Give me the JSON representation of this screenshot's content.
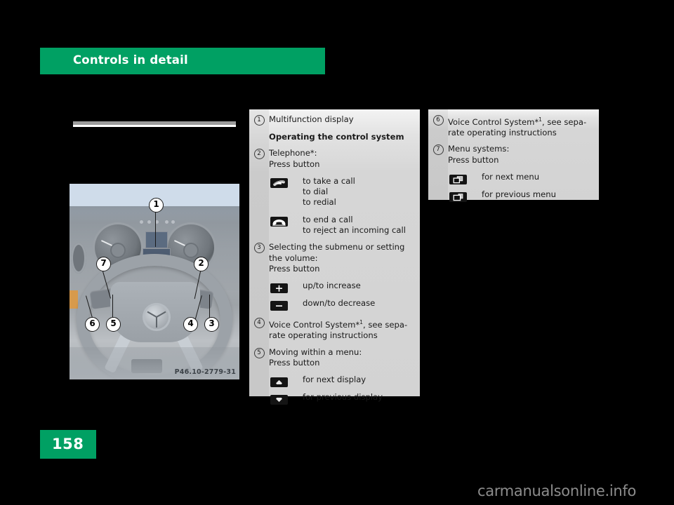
{
  "header": {
    "title": "Controls in detail",
    "band_color": "#00a063"
  },
  "figure": {
    "reference_code": "P46.10-2779-31",
    "callouts": [
      "1",
      "2",
      "3",
      "4",
      "5",
      "6",
      "7"
    ],
    "alt": "Mercedes-Benz steering wheel and instrument cluster with numbered callouts"
  },
  "panel_middle": {
    "items": [
      {
        "num": "1",
        "text": "Multifunction display"
      },
      {
        "heading": "Operating the control system"
      },
      {
        "num": "2",
        "text": "Telephone*:\nPress button",
        "subitems": [
          {
            "icon": "phone-take-call-icon",
            "text": "to take a call\nto dial\nto redial"
          },
          {
            "icon": "phone-end-call-icon",
            "text": "to end a call\nto reject an incoming call"
          }
        ]
      },
      {
        "num": "3",
        "text": "Selecting the submenu or setting the volume:\nPress button",
        "subitems": [
          {
            "icon": "plus-icon",
            "text": "up/to increase"
          },
          {
            "icon": "minus-icon",
            "text": "down/to decrease"
          }
        ]
      },
      {
        "num": "4",
        "text": "Voice Control System*",
        "superscript": "1",
        "text_after": ", see separate operating instructions"
      },
      {
        "num": "5",
        "text": "Moving within a menu:\nPress button",
        "subitems": [
          {
            "icon": "arrow-up-icon",
            "text": "for next display"
          },
          {
            "icon": "arrow-down-icon",
            "text": "for previous display"
          }
        ]
      }
    ],
    "row1_label": "Multifunction display",
    "row2_heading": "Operating the control system",
    "row3_label": "Telephone*:",
    "row3_label2": "Press button",
    "row3_sub1_line1": "to take a call",
    "row3_sub1_line2": "to dial",
    "row3_sub1_line3": "to redial",
    "row3_sub2_line1": "to end a call",
    "row3_sub2_line2": "to reject an incoming call",
    "row4_label": "Selecting the submenu or setting",
    "row4_label2": "the volume:",
    "row4_label3": "Press button",
    "row4_sub1": "up/to increase",
    "row4_sub2": "down/to decrease",
    "row5_label": "Voice Control System*",
    "row5_sup": "1",
    "row5_label_b": ", see sepa-",
    "row5_label_c": "rate operating instructions",
    "row6_label": "Moving within a menu:",
    "row6_label2": "Press button",
    "row6_sub1": "for next display",
    "row6_sub2": "for previous display"
  },
  "panel_right": {
    "row1_num": "6",
    "row1_label": "Voice Control System*",
    "row1_sup": "1",
    "row1_label_b": ", see sepa-",
    "row1_label_c": "rate operating instructions",
    "row2_num": "7",
    "row2_label": "Menu systems:",
    "row2_label2": "Press button",
    "row2_sub1": "for next menu",
    "row2_sub2": "for previous menu"
  },
  "numbers": {
    "n1": "1",
    "n2": "2",
    "n3": "3",
    "n4": "4",
    "n5": "5",
    "n6": "6",
    "n7": "7"
  },
  "footer": {
    "page_number": "158",
    "watermark": "carmanualsonline.info"
  }
}
